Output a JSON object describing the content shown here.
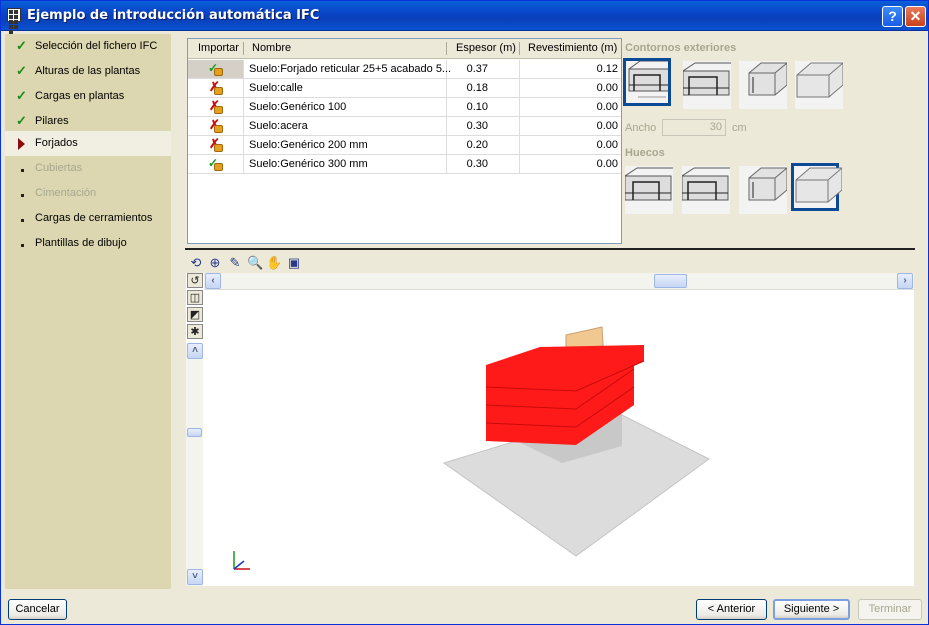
{
  "window": {
    "title": "Ejemplo de introducción automática IFC",
    "help_label": "?",
    "close_label": "✕"
  },
  "steps": [
    {
      "label": "Selección del fichero IFC",
      "state": "done"
    },
    {
      "label": "Alturas de las plantas",
      "state": "done"
    },
    {
      "label": "Cargas en plantas",
      "state": "done"
    },
    {
      "label": "Pilares",
      "state": "done"
    },
    {
      "label": "Forjados",
      "state": "current"
    },
    {
      "label": "Cubiertas",
      "state": "disabled"
    },
    {
      "label": "Cimentación",
      "state": "disabled"
    },
    {
      "label": "Cargas de cerramientos",
      "state": "pending"
    },
    {
      "label": "Plantillas de dibujo",
      "state": "pending"
    }
  ],
  "table": {
    "columns": [
      "Importar",
      "Nombre",
      "Espesor (m)",
      "Revestimiento (m)"
    ],
    "rows": [
      {
        "import": true,
        "name": "Suelo:Forjado reticular 25+5 acabado 5...",
        "espesor": "0.37",
        "revestimiento": "0.12"
      },
      {
        "import": false,
        "name": "Suelo:calle",
        "espesor": "0.18",
        "revestimiento": "0.00"
      },
      {
        "import": false,
        "name": "Suelo:Genérico 100",
        "espesor": "0.10",
        "revestimiento": "0.00"
      },
      {
        "import": false,
        "name": "Suelo:acera",
        "espesor": "0.30",
        "revestimiento": "0.00"
      },
      {
        "import": false,
        "name": "Suelo:Genérico 200 mm",
        "espesor": "0.20",
        "revestimiento": "0.00"
      },
      {
        "import": true,
        "name": "Suelo:Genérico 300 mm",
        "espesor": "0.30",
        "revestimiento": "0.00"
      }
    ]
  },
  "contornos": {
    "label": "Contornos exteriores",
    "selected": 1
  },
  "ancho": {
    "label": "Ancho",
    "value": "30",
    "unit": "cm"
  },
  "huecos": {
    "label": "Huecos",
    "selected": 4
  },
  "buttons": {
    "cancel": "Cancelar",
    "back": "< Anterior",
    "next": "Siguiente >",
    "finish": "Terminar"
  },
  "colors": {
    "slab": "#ff1a1a",
    "title_bar": "#0a4fd0",
    "selected_option": "#0d4a96"
  }
}
